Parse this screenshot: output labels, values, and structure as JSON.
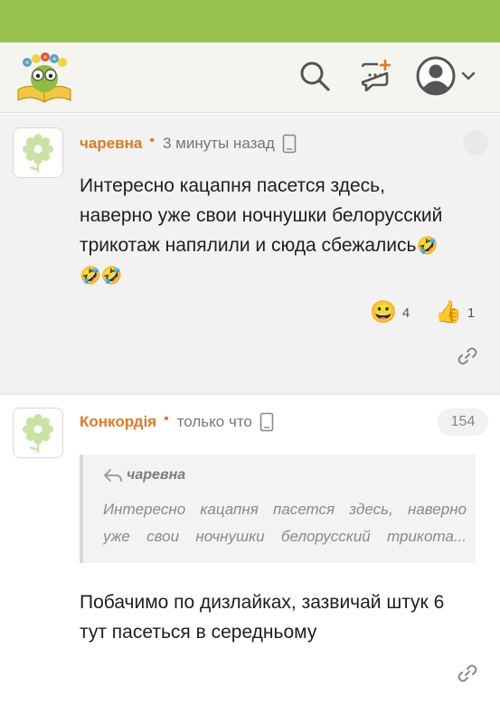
{
  "header": {
    "logo_icon": "owl-with-book-logo",
    "search_icon": "search-icon",
    "new_post_icon": "new-post-icon",
    "profile_icon": "user-avatar-icon"
  },
  "comments": [
    {
      "author": "чаревна",
      "separator": "•",
      "time": "3 минуты назад",
      "text_lines": [
        "Интересно кацапня пасется здесь,",
        "наверно уже свои ночнушки белорусский",
        "трикотаж напялили и сюда сбежались"
      ],
      "emojis": [
        "🤣",
        "🤣",
        "🤣"
      ],
      "reactions": [
        {
          "emoji": "😀",
          "count": "4"
        },
        {
          "emoji": "👍",
          "count": "1"
        }
      ]
    },
    {
      "author": "Конкордія",
      "separator": "•",
      "time": "только что",
      "badge": "154",
      "quote": {
        "author": "чаревна",
        "line1": "Интересно кацапня пасется здесь, наверно",
        "line2": "уже свои ночнушки белорусский трикота..."
      },
      "text_lines": [
        "Побачимо по дизлайках, зазвичай штук 6",
        "тут пасеться в середньому"
      ]
    }
  ],
  "colors": {
    "topbar": "#96c24d",
    "author": "#e07a1f"
  }
}
